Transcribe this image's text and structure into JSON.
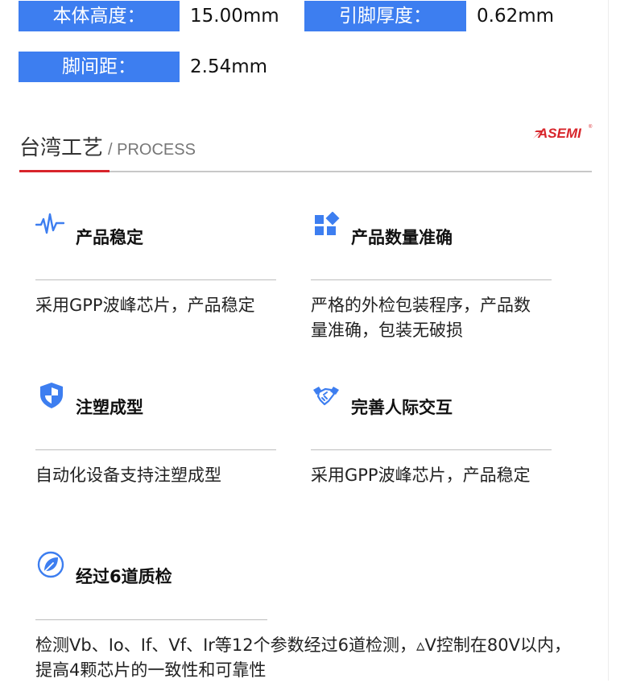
{
  "specs": [
    {
      "label": "本体高度：",
      "value": "15.00mm"
    },
    {
      "label": "引脚厚度：",
      "value": "0.62mm"
    },
    {
      "label": "脚间距：",
      "value": "2.54mm"
    }
  ],
  "section": {
    "title": "台湾工艺",
    "subtitle": "/ PROCESS"
  },
  "logo": {
    "text": "ASEMI",
    "color": "#d8252b"
  },
  "features": [
    {
      "icon": "pulse-wave-icon",
      "title": "产品稳定",
      "desc": "采用GPP波峰芯片，产品稳定"
    },
    {
      "icon": "apps-grid-icon",
      "title": "产品数量准确",
      "desc": "严格的外检包装程序，产品数量准确，包装无破损"
    },
    {
      "icon": "shield-icon",
      "title": "注塑成型",
      "desc": "自动化设备支持注塑成型"
    },
    {
      "icon": "handshake-icon",
      "title": "完善人际交互",
      "desc": "采用GPP波峰芯片，产品稳定"
    },
    {
      "icon": "leaf-icon",
      "title": "经过6道质检",
      "desc": "检测Vb、Io、If、Vf、Ir等12个参数经过6道检测，▵V控制在80V以内，提高4颗芯片的一致性和可靠性"
    }
  ],
  "colors": {
    "accent_blue": "#3d7ef0",
    "accent_red": "#d8252b"
  }
}
